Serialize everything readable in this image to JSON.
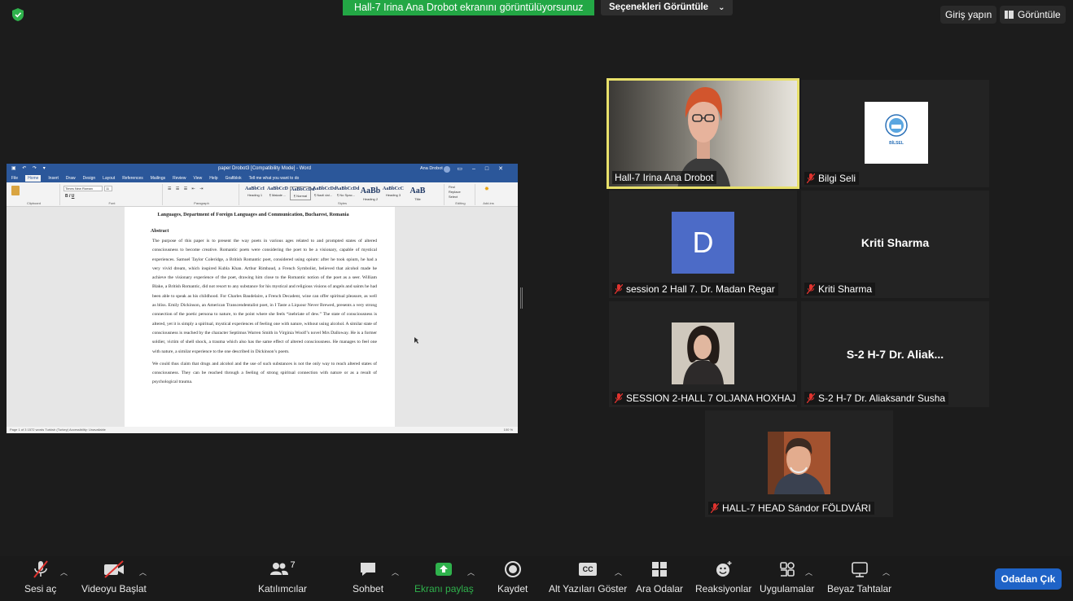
{
  "top_bar": {
    "share_banner": "Hall-7 Irina Ana Drobot ekranını görüntülüyorsunuz",
    "view_options": "Seçenekleri Görüntüle",
    "sign_in": "Giriş yapın",
    "view": "Görüntüle"
  },
  "word": {
    "title": "paper Drobot3 [Compatibility Mode] - Word",
    "user": "Ana Drobot",
    "tabs": [
      "File",
      "Home",
      "Insert",
      "Draw",
      "Design",
      "Layout",
      "References",
      "Mailings",
      "Review",
      "View",
      "Help",
      "Grafiblok",
      "Tell me what you want to do"
    ],
    "ribbon": {
      "clipboard": "Clipboard",
      "font": "Font",
      "paragraph": "Paragraph",
      "styles": "Styles",
      "editing": "Editing",
      "addins": "Add-ins",
      "font_name": "Times New Roman",
      "font_size": "11",
      "style_items": [
        {
          "sample": "AaBbCcI",
          "label": "Heading 1"
        },
        {
          "sample": "AaBbCcD",
          "label": "¶ Makale ..."
        },
        {
          "sample": "AaBbCcDd",
          "label": "¶ Normal"
        },
        {
          "sample": "AaBbCcDd",
          "label": "¶ Nazli dal..."
        },
        {
          "sample": "AaBbCcDd",
          "label": "¶ No Spac..."
        },
        {
          "sample": "AaBb",
          "label": "Heading 2"
        },
        {
          "sample": "AaBbCcC",
          "label": "Heading 3"
        },
        {
          "sample": "AaB",
          "label": "Title"
        }
      ],
      "find": "Find",
      "replace": "Replace",
      "select": "Select"
    },
    "affiliation": "Languages, Department of Foreign Languages and Communication, Bucharest, Romania",
    "abstract_heading": "Abstract",
    "paragraph1": "The purpose of this paper is to present the way poets in various ages related to and prompted states of altered consciousness to become creative. Romantic poets were considering the poet to be a visionary, capable of mystical experiences. Samuel Taylor Coleridge, a British Romantic poet, considered using opium: after he took opium, he had a very vivid dream, which inspired Kubla Khan. Arthur Rimbaud, a French Symbolist, believed that alcohol made he achieve the visionary experience of the poet, drawing him close to the Romantic notion of the poet as a seer. William Blake, a British Romantic, did not resort to any substance for his mystical and religious visions of angels and saints he had been able to speak as his childhood. For Charles Baudelaire, a French Decadent, wine can offer spiritual pleasure, as well as bliss. Emily Dickinson, an American Transcendentalist poet, in I Taste a Liquour Never Brewed, presents a very strong connection of the poetic persona to nature, to the point where she feels “inebriate of dew.” The state of consciousness is altered, yet it is simply a spiritual, mystical experiences of feeling one with nature, without using alcohol. A similar state of consciousness is reached by the character Septimus Warren Smith in Virginia Woolf’s novel Mrs Dalloway. He is a former soldier, victim of shell shock, a trauma which also has the same effect of altered consciousness. He manages to feel one with nature, a similar experience to the one described in Dickinson’s poem.",
    "paragraph2": "We could thus claim that drugs and alcohol and the use of such substances is not the only way to reach altered states of consciousness. They can be reached through a feeling of strong spiritual connection with nature or as a result of psychological trauma.",
    "status_left": "Page 1 of 3    1572 words    Turkish (Turkey)    Accessibility: Unavailable",
    "status_zoom": "100 %"
  },
  "participants": [
    {
      "name": "Hall-7 Irina Ana Drobot",
      "muted": false,
      "video": "camera"
    },
    {
      "name": "Bilgi Seli",
      "muted": true,
      "video": "logo",
      "logo_text": "BİLSEL"
    },
    {
      "name": "session 2 Hall 7. Dr. Madan Regar",
      "muted": true,
      "video": "avatar",
      "avatar_letter": "D"
    },
    {
      "name": "Kriti Sharma",
      "muted": true,
      "video": "name",
      "display_name": "Kriti Sharma"
    },
    {
      "name": "SESSION 2-HALL 7 OLJANA HOXHAJ",
      "muted": true,
      "video": "photo"
    },
    {
      "name": "S-2 H-7 Dr. Aliaksandr Susha",
      "muted": true,
      "video": "name",
      "display_name": "S-2 H-7 Dr. Aliak..."
    },
    {
      "name": "HALL-7 HEAD Sándor FÖLDVÁRI",
      "muted": true,
      "video": "photo"
    }
  ],
  "toolbar": {
    "audio": "Sesi aç",
    "video": "Videoyu Başlat",
    "participants": "Katılımcılar",
    "participants_count": "7",
    "chat": "Sohbet",
    "share": "Ekranı paylaş",
    "record": "Kaydet",
    "captions": "Alt Yazıları Göster",
    "captions_badge": "CC",
    "breakout": "Ara Odalar",
    "reactions": "Reaksiyonlar",
    "apps": "Uygulamalar",
    "whiteboard": "Beyaz Tahtalar",
    "leave": "Odadan Çık"
  },
  "colors": {
    "share_green": "#23a745",
    "leave_blue": "#1f63c7",
    "word_blue": "#2b579a",
    "active_speaker": "#e8e06a",
    "muted_red": "#e0332e"
  }
}
